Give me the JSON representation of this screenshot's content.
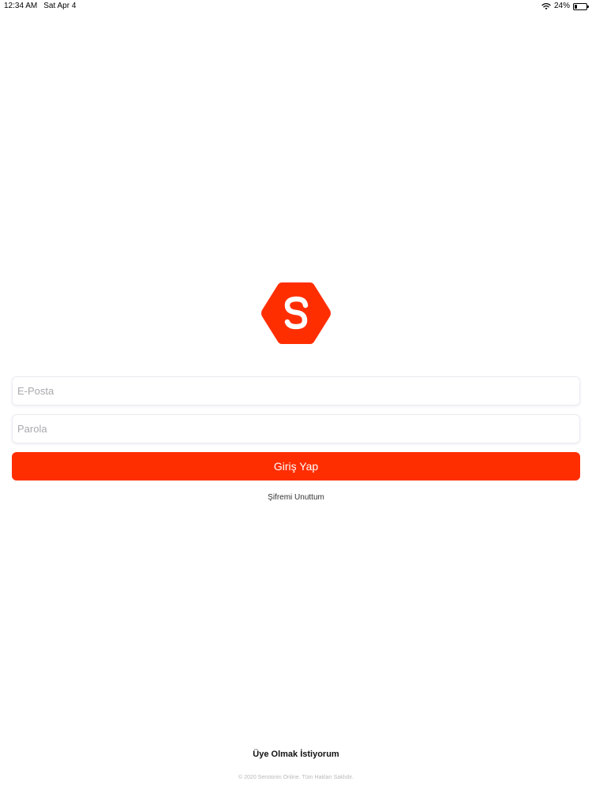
{
  "status_bar": {
    "time": "12:34 AM",
    "date": "Sat Apr 4",
    "battery_percent_label": "24%",
    "battery_level": 0.24,
    "icons": [
      "wifi-icon",
      "battery-icon"
    ]
  },
  "brand": {
    "accent_color": "#ff2e00",
    "logo_icon": "hexagon-s-logo"
  },
  "login_form": {
    "email_placeholder": "E-Posta",
    "email_value": "",
    "password_placeholder": "Parola",
    "password_value": "",
    "submit_label": "Giriş Yap",
    "forgot_password_label": "Şifremi Unuttum"
  },
  "footer": {
    "register_label": "Üye Olmak İstiyorum",
    "copyright": "© 2020 Serotonin Online. Tüm Hakları Saklıdır."
  }
}
